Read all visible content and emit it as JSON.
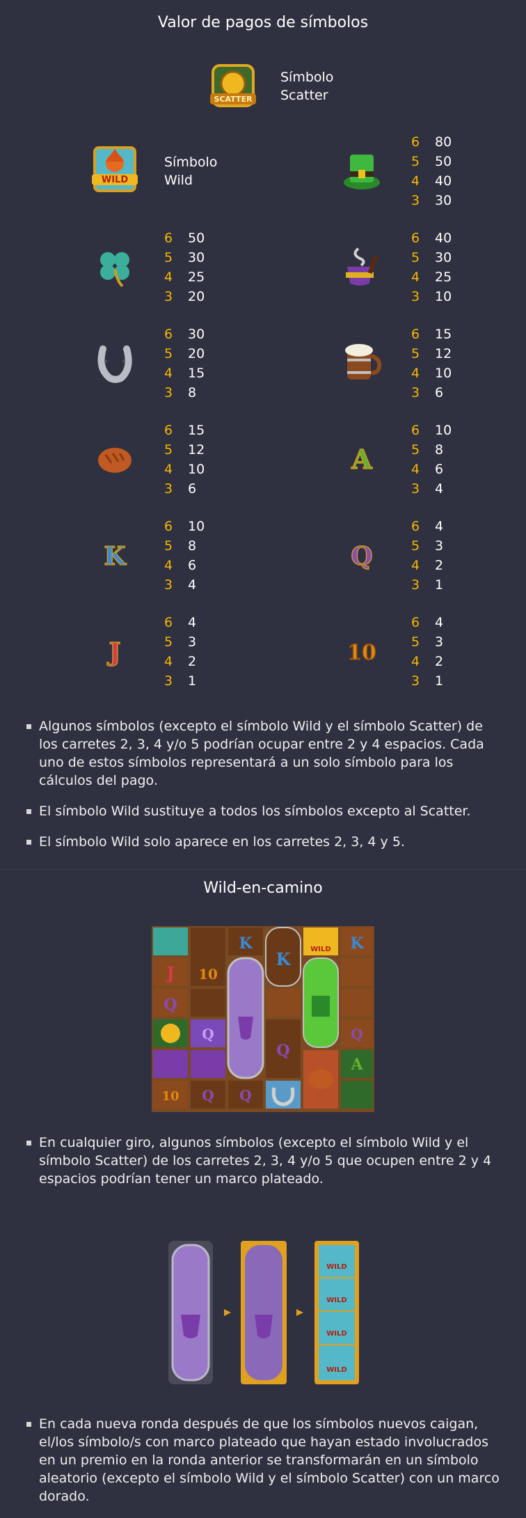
{
  "section1": {
    "title": "Valor de pagos de símbolos"
  },
  "scatter": {
    "label": "Símbolo Scatter",
    "icon": "scatter-icon"
  },
  "wild": {
    "label": "Símbolo Wild",
    "icon": "wild-icon"
  },
  "paytable": [
    {
      "icon": "leprechaun-hat-icon",
      "pays": [
        {
          "n": "6",
          "v": "80"
        },
        {
          "n": "5",
          "v": "50"
        },
        {
          "n": "4",
          "v": "40"
        },
        {
          "n": "3",
          "v": "30"
        }
      ]
    },
    {
      "icon": "clover-icon",
      "pays": [
        {
          "n": "6",
          "v": "50"
        },
        {
          "n": "5",
          "v": "30"
        },
        {
          "n": "4",
          "v": "25"
        },
        {
          "n": "3",
          "v": "20"
        }
      ]
    },
    {
      "icon": "pipe-icon",
      "pays": [
        {
          "n": "6",
          "v": "40"
        },
        {
          "n": "5",
          "v": "30"
        },
        {
          "n": "4",
          "v": "25"
        },
        {
          "n": "3",
          "v": "10"
        }
      ]
    },
    {
      "icon": "horseshoe-icon",
      "pays": [
        {
          "n": "6",
          "v": "30"
        },
        {
          "n": "5",
          "v": "20"
        },
        {
          "n": "4",
          "v": "15"
        },
        {
          "n": "3",
          "v": "8"
        }
      ]
    },
    {
      "icon": "beer-mug-icon",
      "pays": [
        {
          "n": "6",
          "v": "15"
        },
        {
          "n": "5",
          "v": "12"
        },
        {
          "n": "4",
          "v": "10"
        },
        {
          "n": "3",
          "v": "6"
        }
      ]
    },
    {
      "icon": "bread-icon",
      "pays": [
        {
          "n": "6",
          "v": "15"
        },
        {
          "n": "5",
          "v": "12"
        },
        {
          "n": "4",
          "v": "10"
        },
        {
          "n": "3",
          "v": "6"
        }
      ]
    },
    {
      "icon": "letter-a-icon",
      "pays": [
        {
          "n": "6",
          "v": "10"
        },
        {
          "n": "5",
          "v": "8"
        },
        {
          "n": "4",
          "v": "6"
        },
        {
          "n": "3",
          "v": "4"
        }
      ]
    },
    {
      "icon": "letter-k-icon",
      "pays": [
        {
          "n": "6",
          "v": "10"
        },
        {
          "n": "5",
          "v": "8"
        },
        {
          "n": "4",
          "v": "6"
        },
        {
          "n": "3",
          "v": "4"
        }
      ]
    },
    {
      "icon": "letter-q-icon",
      "pays": [
        {
          "n": "6",
          "v": "4"
        },
        {
          "n": "5",
          "v": "3"
        },
        {
          "n": "4",
          "v": "2"
        },
        {
          "n": "3",
          "v": "1"
        }
      ]
    },
    {
      "icon": "letter-j-icon",
      "pays": [
        {
          "n": "6",
          "v": "4"
        },
        {
          "n": "5",
          "v": "3"
        },
        {
          "n": "4",
          "v": "2"
        },
        {
          "n": "3",
          "v": "1"
        }
      ]
    },
    {
      "icon": "number-10-icon",
      "pays": [
        {
          "n": "6",
          "v": "4"
        },
        {
          "n": "5",
          "v": "3"
        },
        {
          "n": "4",
          "v": "2"
        },
        {
          "n": "3",
          "v": "1"
        }
      ]
    }
  ],
  "symbols": {
    "a": "A",
    "k": "K",
    "q": "Q",
    "j": "J",
    "ten": "10",
    "wild": "WILD",
    "scatter": "SCATTER"
  },
  "rules1": [
    "Algunos símbolos (excepto el símbolo Wild y el símbolo Scatter) de los carretes 2, 3, 4 y/o 5 podrían ocupar entre 2 y 4 espacios. Cada uno de estos símbolos representará a un solo símbolo para los cálculos del pago.",
    "El símbolo Wild sustituye a todos los símbolos excepto al Scatter.",
    "El símbolo Wild solo aparece en los carretes 2, 3, 4 y 5."
  ],
  "section2": {
    "title": "Wild-en-camino"
  },
  "rules2": [
    "En cualquier giro, algunos símbolos (excepto el símbolo Wild y el símbolo Scatter) de los carretes 2, 3, 4 y/o 5 que ocupen entre 2 y 4 espacios podrían tener un marco plateado.",
    "En cada nueva ronda después de que los símbolos nuevos caigan, el/los símbolo/s con marco plateado que hayan estado involucrados en un premio en la ronda anterior se transformarán en un símbolo aleatorio (excepto el símbolo Wild y el símbolo Scatter) con un marco dorado."
  ],
  "colors": {
    "background": "#2f3040",
    "count": "#f5b800",
    "text": "#ffffff"
  }
}
